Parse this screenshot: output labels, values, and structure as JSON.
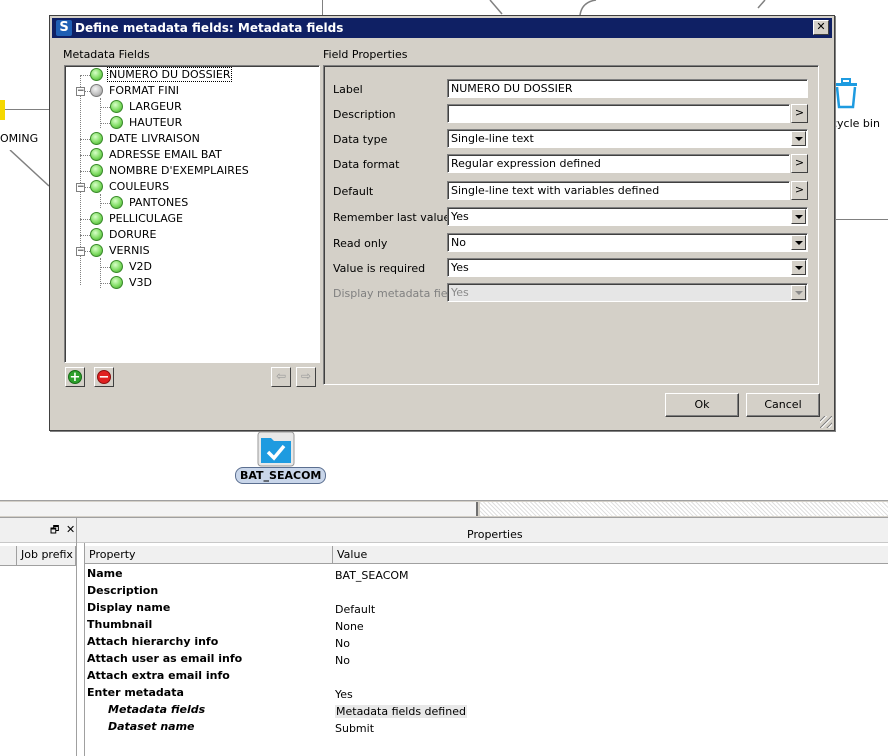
{
  "window": {
    "title": "Define metadata fields: Metadata fields",
    "close_symbol": "✕",
    "app_icon_letter": "S"
  },
  "canvas": {
    "partial_label_left": "OMING",
    "partial_label_recycle": "cycle bin",
    "flow_element_label": "BAT_SEACOM",
    "icons": [
      "recycle-bin-icon",
      "folder-check-icon"
    ]
  },
  "tree": {
    "heading": "Metadata Fields",
    "items": [
      {
        "label": "NUMERO DU DOSSIER",
        "state": "green",
        "selected": true
      },
      {
        "label": "FORMAT FINI",
        "state": "gray",
        "expander": "−"
      },
      {
        "label": "LARGEUR",
        "state": "green"
      },
      {
        "label": "HAUTEUR",
        "state": "green"
      },
      {
        "label": "DATE LIVRAISON",
        "state": "green"
      },
      {
        "label": "ADRESSE EMAIL BAT",
        "state": "green"
      },
      {
        "label": "NOMBRE D'EXEMPLAIRES",
        "state": "green"
      },
      {
        "label": "COULEURS",
        "state": "green",
        "expander": "−"
      },
      {
        "label": "PANTONES",
        "state": "green"
      },
      {
        "label": "PELLICULAGE",
        "state": "green"
      },
      {
        "label": "DORURE",
        "state": "green"
      },
      {
        "label": "VERNIS",
        "state": "green",
        "expander": "−"
      },
      {
        "label": "V2D",
        "state": "green"
      },
      {
        "label": "V3D",
        "state": "green"
      }
    ],
    "add_symbol": "+",
    "remove_symbol": "−",
    "move_left_symbol": "⇦",
    "move_right_symbol": "⇨"
  },
  "field_properties": {
    "heading": "Field Properties",
    "rows": [
      {
        "label": "Label",
        "value": "NUMERO DU DOSSIER",
        "kind": "text"
      },
      {
        "label": "Description",
        "value": "",
        "kind": "button",
        "button": ">"
      },
      {
        "label": "Data type",
        "value": "Single-line text",
        "kind": "dropdown"
      },
      {
        "label": "Data format",
        "value": "Regular expression defined",
        "kind": "button",
        "button": ">"
      },
      {
        "label": "Default",
        "value": "Single-line text with variables defined",
        "kind": "button",
        "button": ">"
      },
      {
        "label": "Remember last value",
        "value": "Yes",
        "kind": "dropdown"
      },
      {
        "label": "Read only",
        "value": "No",
        "kind": "dropdown"
      },
      {
        "label": "Value is required",
        "value": "Yes",
        "kind": "dropdown"
      },
      {
        "label": "Display metadata field",
        "value": "Yes",
        "kind": "dropdown",
        "disabled": true
      }
    ]
  },
  "buttons": {
    "ok": "Ok",
    "cancel": "Cancel"
  },
  "left_panel": {
    "column": "Job prefix",
    "restore_symbol": "🗗",
    "close_symbol": "✕"
  },
  "properties_panel": {
    "title": "Properties",
    "col_property": "Property",
    "col_value": "Value",
    "rows": [
      {
        "name": "Name",
        "value": "BAT_SEACOM"
      },
      {
        "name": "Description",
        "value": ""
      },
      {
        "name": "Display name",
        "value": "Default"
      },
      {
        "name": "Thumbnail",
        "value": "None"
      },
      {
        "name": "Attach hierarchy info",
        "value": "No"
      },
      {
        "name": "Attach user as email info",
        "value": "No"
      },
      {
        "name": "Attach extra email info",
        "value": ""
      },
      {
        "name": "Enter metadata",
        "value": "Yes"
      },
      {
        "name": "Metadata fields",
        "value": "Metadata fields defined",
        "sub": true,
        "highlight": true
      },
      {
        "name": "Dataset name",
        "value": "Submit",
        "sub": true
      }
    ]
  }
}
